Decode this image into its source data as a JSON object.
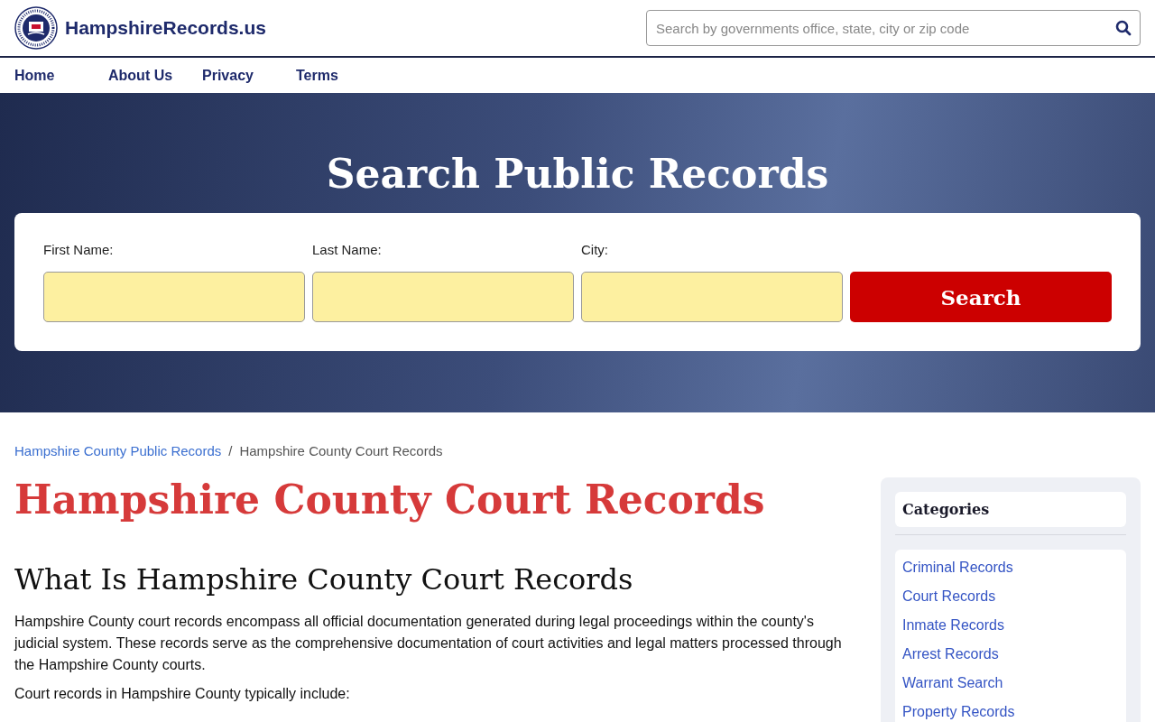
{
  "site": {
    "name": "HampshireRecords.us",
    "search": {
      "placeholder": "Search by governments office, state, city or zip code"
    }
  },
  "nav": [
    "Home",
    "About Us",
    "Privacy",
    "Terms"
  ],
  "hero": {
    "title": "Search Public Records",
    "fields": [
      {
        "label": "First Name:"
      },
      {
        "label": "Last Name:"
      },
      {
        "label": "City:"
      }
    ],
    "button": "Search"
  },
  "breadcrumb": [
    {
      "label": "Hampshire County Public Records",
      "link": true
    },
    {
      "label": "Hampshire County Court Records",
      "link": false
    }
  ],
  "separator": "/",
  "title": "Hampshire County Court Records",
  "article": {
    "heading": "What Is Hampshire County Court Records",
    "paragraphs": [
      "Hampshire County court records encompass all official documentation generated during legal proceedings within the county's judicial system. These records serve as the comprehensive documentation of court activities and legal matters processed through the Hampshire County courts.",
      "Court records in Hampshire County typically include:"
    ]
  },
  "sidebar": {
    "title": "Categories",
    "items": [
      "Criminal Records",
      "Court Records",
      "Inmate Records",
      "Arrest Records",
      "Warrant Search",
      "Property Records"
    ]
  }
}
